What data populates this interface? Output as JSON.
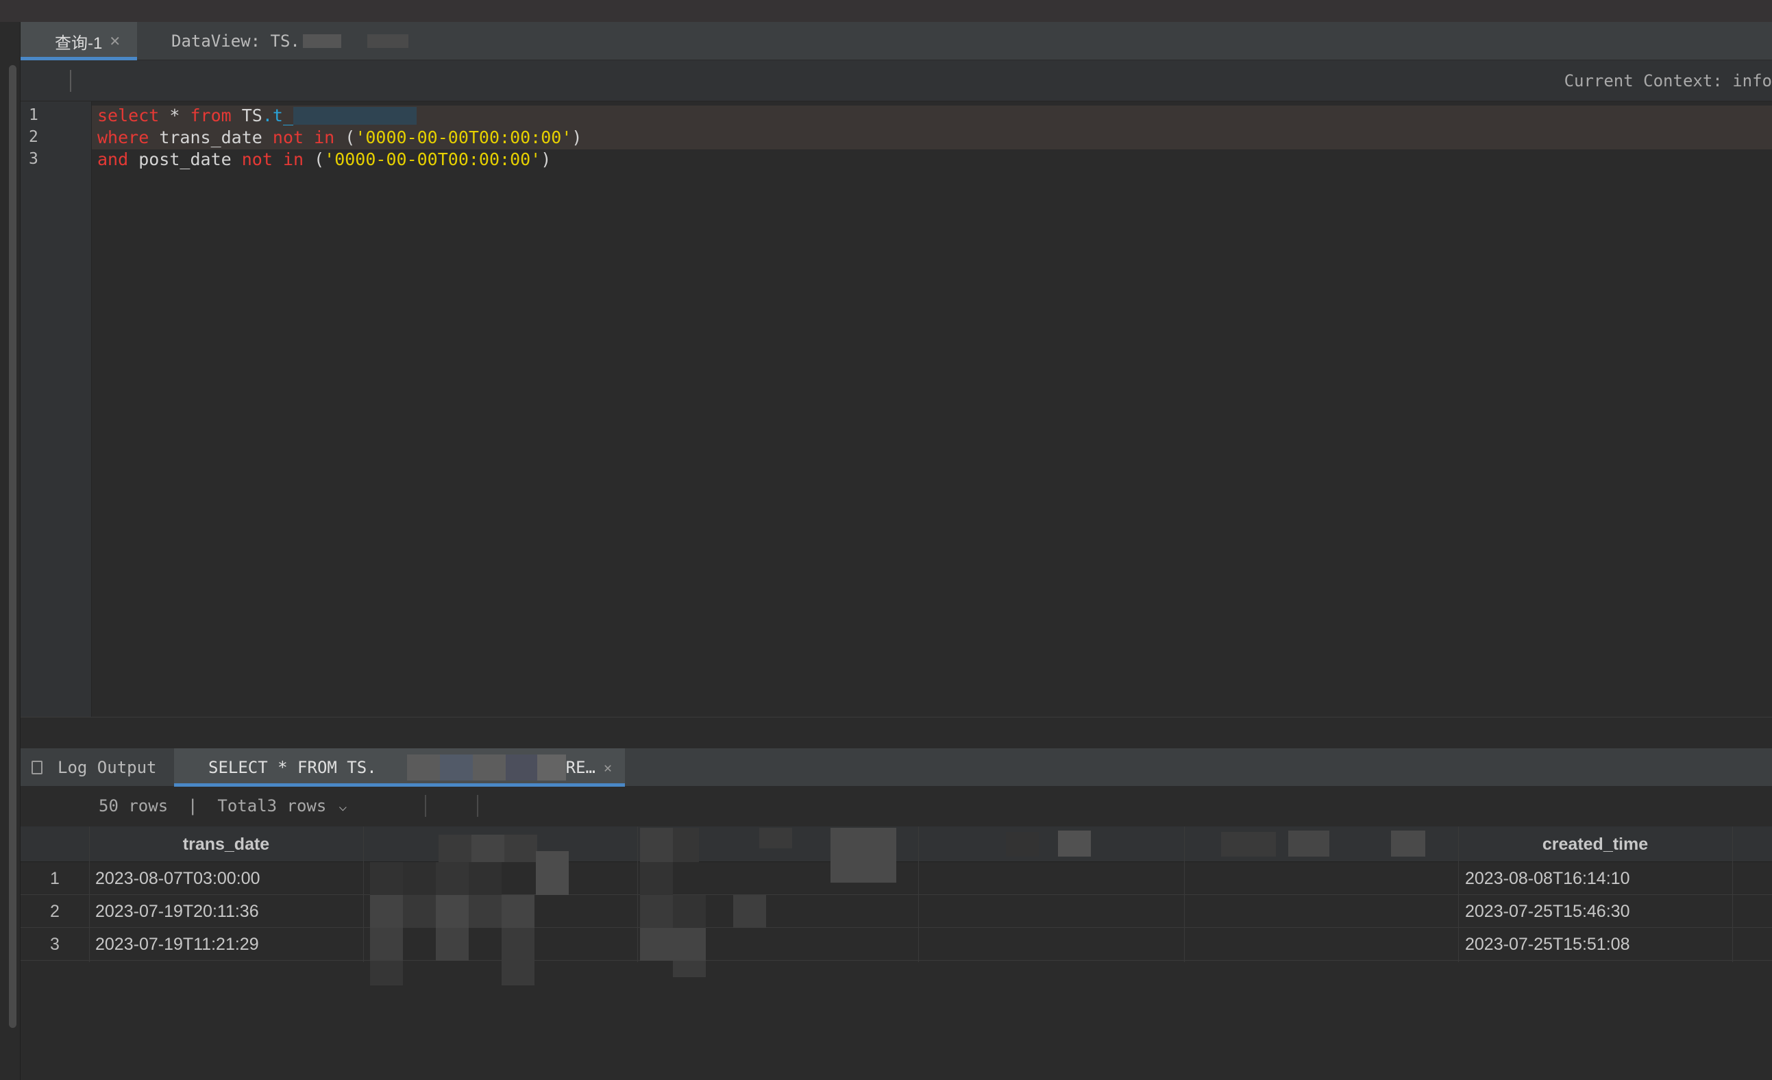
{
  "editor_tabs": [
    {
      "label": "查询-1",
      "active": true
    },
    {
      "label": "DataView: TS."
    }
  ],
  "context_label": "Current Context: info",
  "code": {
    "line_numbers": [
      "1",
      "2",
      "3"
    ],
    "line1": {
      "kw1": "select",
      "op": " * ",
      "kw2": "from",
      "schema": " TS",
      "table": ".t_"
    },
    "line2": {
      "kw": "where",
      "col": " trans_date ",
      "kw2": "not",
      "kw3": " in",
      "open": " (",
      "str": "'0000-00-00T00:00:00'",
      "close": ")"
    },
    "line3": {
      "kw": "and",
      "col": " post_date ",
      "kw2": "not",
      "kw3": " in",
      "open": " (",
      "str": "'0000-00-00T00:00:00'",
      "close": ")"
    }
  },
  "result_tabs": {
    "log_label": "Log Output",
    "select_label": "SELECT * FROM TS.",
    "select_suffix": "RE…"
  },
  "rows_info": "50 rows  |  Total3 rows",
  "grid": {
    "columns": [
      "trans_date",
      "created_time"
    ],
    "rows": [
      {
        "num": "1",
        "trans_date": "2023-08-07T03:00:00",
        "created_time": "2023-08-08T16:14:10"
      },
      {
        "num": "2",
        "trans_date": "2023-07-19T20:11:36",
        "created_time": "2023-07-25T15:46:30"
      },
      {
        "num": "3",
        "trans_date": "2023-07-19T11:21:29",
        "created_time": "2023-07-25T15:51:08"
      }
    ]
  },
  "colors": {
    "keyword": "#e53935",
    "string": "#e6d000",
    "table_ref": "#2aa3d8",
    "active_tab_underline": "#4a88c7"
  }
}
